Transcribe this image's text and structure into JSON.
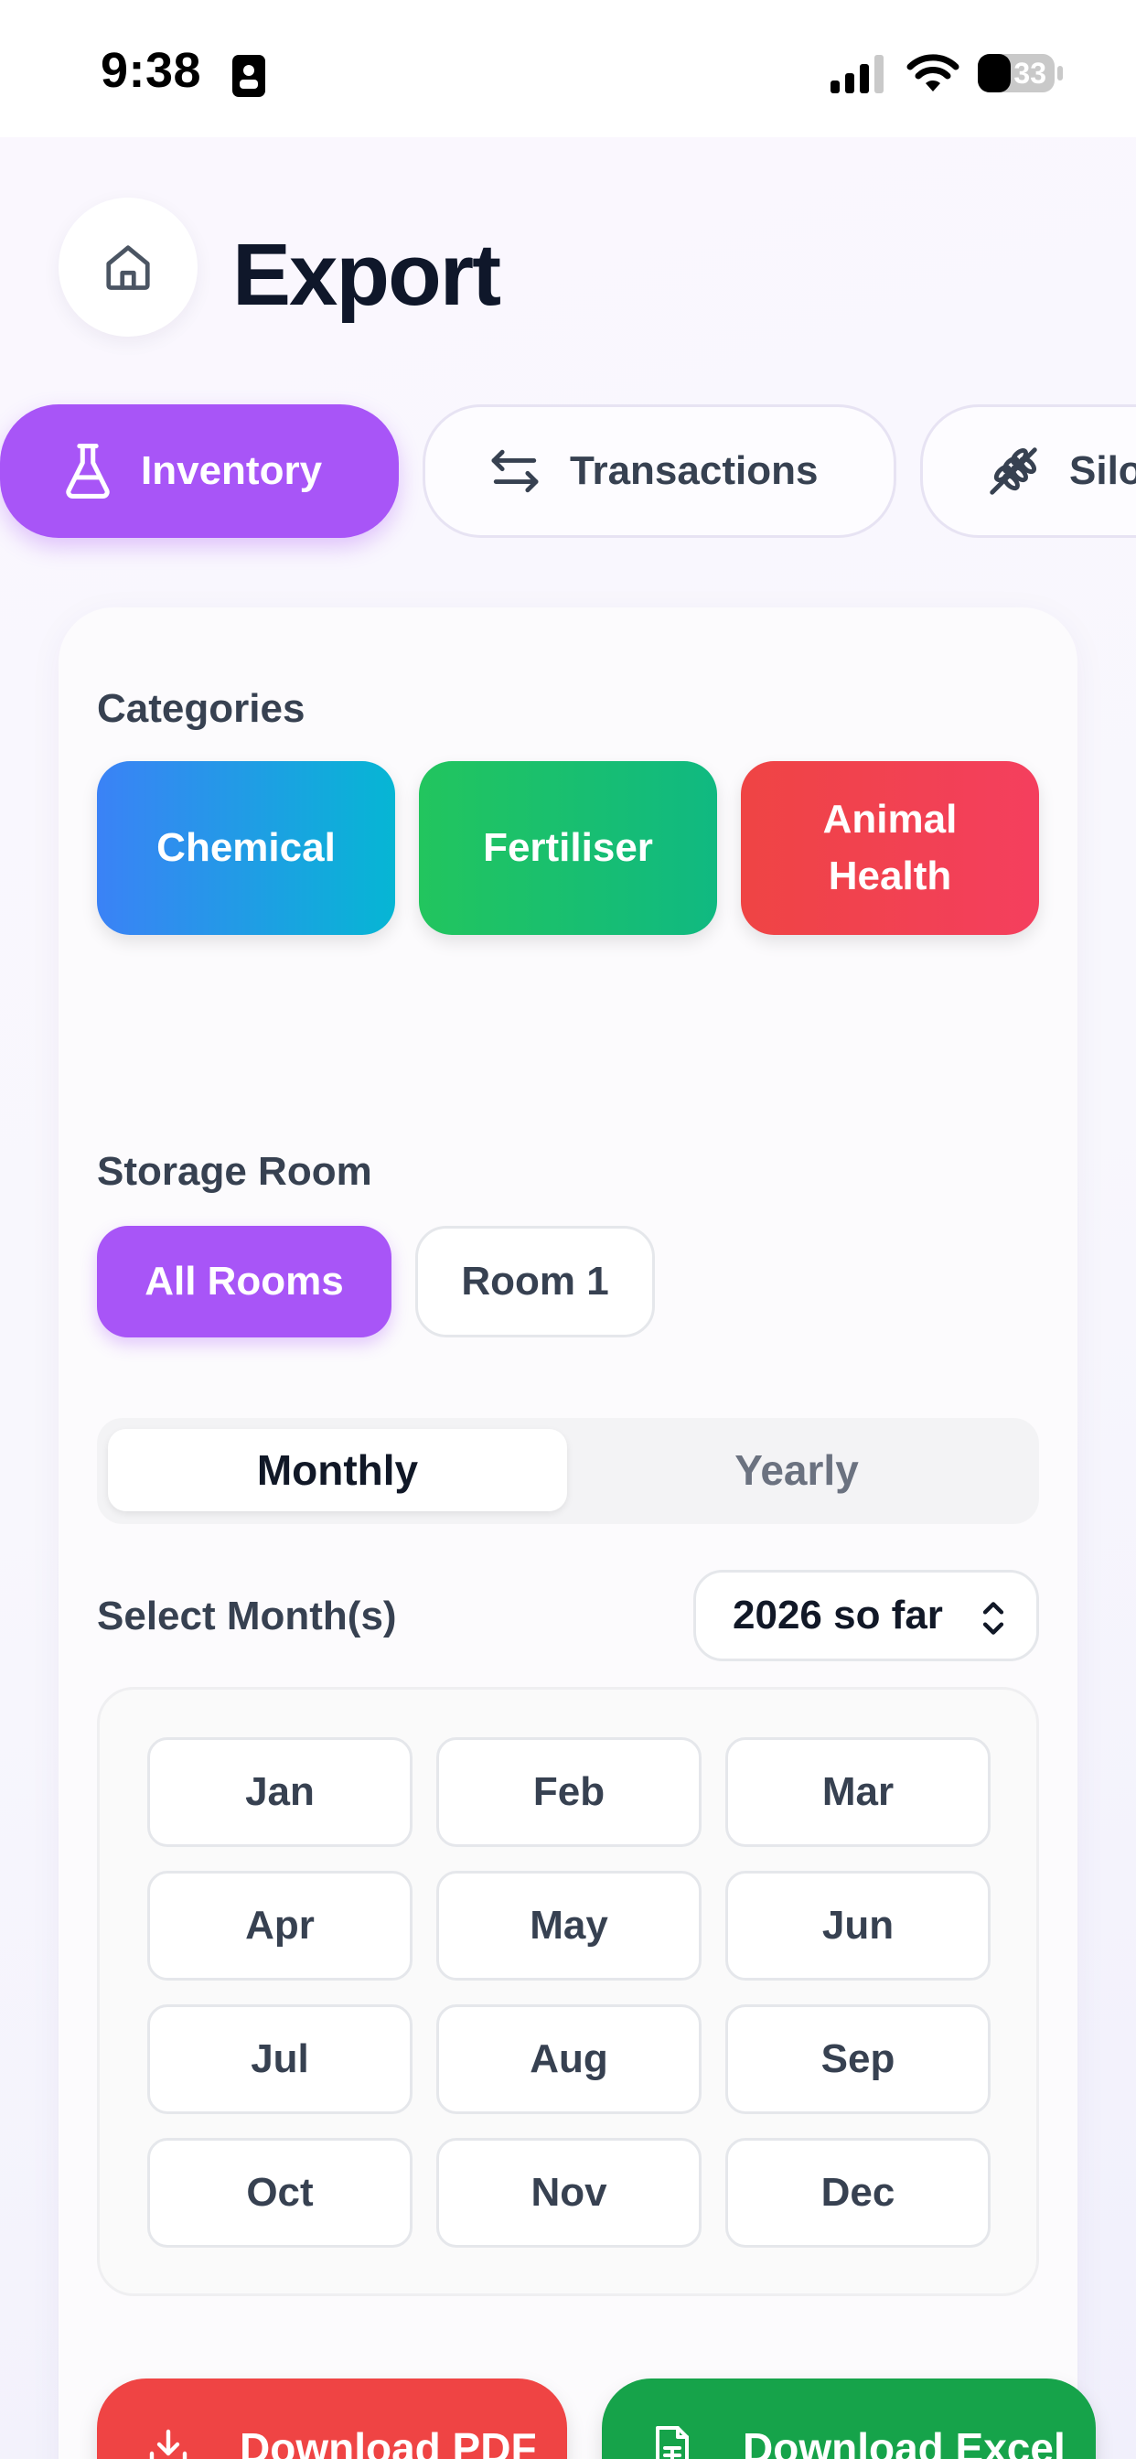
{
  "status_bar": {
    "time": "9:38",
    "battery": "33"
  },
  "header": {
    "title": "Export"
  },
  "tabs": [
    {
      "label": "Inventory",
      "icon": "flask-icon",
      "active": true
    },
    {
      "label": "Transactions",
      "icon": "arrows-swap-icon",
      "active": false
    },
    {
      "label": "Silo",
      "icon": "wheat-icon",
      "active": false
    }
  ],
  "categories": {
    "label": "Categories",
    "items": [
      "Chemical",
      "Fertiliser",
      "Animal Health"
    ]
  },
  "storage": {
    "label": "Storage Room",
    "items": [
      "All Rooms",
      "Room 1"
    ],
    "selected": "All Rooms"
  },
  "period": {
    "options": [
      "Monthly",
      "Yearly"
    ],
    "selected": "Monthly"
  },
  "months": {
    "label": "Select Month(s)",
    "year_value": "2026 so far",
    "items": [
      "Jan",
      "Feb",
      "Mar",
      "Apr",
      "May",
      "Jun",
      "Jul",
      "Aug",
      "Sep",
      "Oct",
      "Nov",
      "Dec"
    ]
  },
  "actions": {
    "pdf": "Download PDF",
    "excel": "Download Excel"
  },
  "colors": {
    "accent": "#a855f7",
    "pdf": "#ef4444",
    "excel": "#16a34a"
  }
}
